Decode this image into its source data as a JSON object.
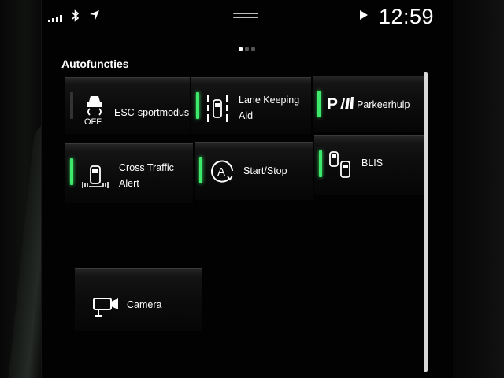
{
  "status_bar": {
    "time": "12:59",
    "bluetooth_icon": "bluetooth-icon",
    "location_icon": "location-arrow-icon",
    "media_icon": "play-icon"
  },
  "section": {
    "title": "Autofuncties"
  },
  "tiles": [
    {
      "id": "esc",
      "label": "ESC-sportmodus",
      "icon": "esc-off-icon",
      "active": false,
      "icon_text": "OFF"
    },
    {
      "id": "lane",
      "label": "Lane Keeping Aid",
      "icon": "lane-keeping-icon",
      "active": true
    },
    {
      "id": "park",
      "label": "Parkeerhulp",
      "icon": "parking-assist-icon",
      "active": true,
      "icon_text": "P"
    },
    {
      "id": "cross",
      "label": "Cross Traffic Alert",
      "icon": "cross-traffic-icon",
      "active": true
    },
    {
      "id": "startstop",
      "label": "Start/Stop",
      "icon": "start-stop-icon",
      "active": true,
      "icon_text": "A"
    },
    {
      "id": "blis",
      "label": "BLIS",
      "icon": "blis-icon",
      "active": true
    },
    {
      "id": "camera",
      "label": "Camera",
      "icon": "camera-icon",
      "active": false
    }
  ],
  "colors": {
    "indicator_on": "#3ee86a",
    "indicator_off": "#333333",
    "background": "#020202"
  }
}
